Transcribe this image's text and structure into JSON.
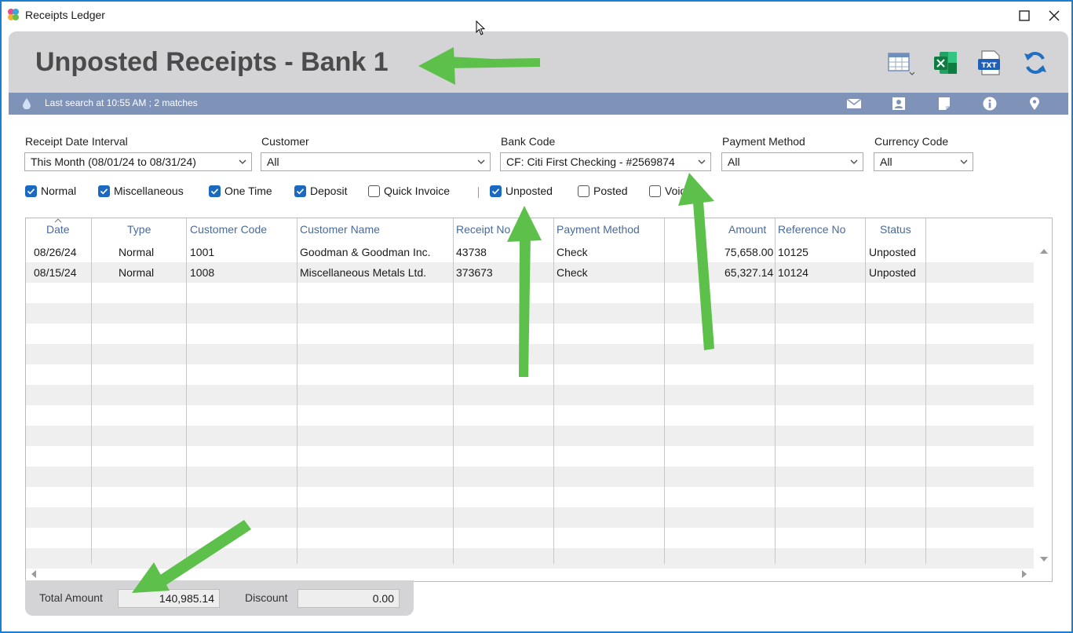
{
  "window": {
    "title": "Receipts Ledger",
    "max_glyph": "☐",
    "close_glyph": "✕"
  },
  "header": {
    "title": "Unposted Receipts - Bank 1",
    "tools": [
      {
        "icon": "column-chooser-icon"
      },
      {
        "icon": "excel-export-icon"
      },
      {
        "icon": "txt-export-icon"
      },
      {
        "icon": "refresh-icon"
      }
    ]
  },
  "statusbar": {
    "text": "Last search at 10:55 AM ; 2 matches",
    "icons": [
      "mail-icon",
      "contact-icon",
      "note-icon",
      "info-icon",
      "location-pin-icon"
    ],
    "bg_color": "#7f92b8"
  },
  "filters": {
    "receipt_date": {
      "label": "Receipt Date Interval",
      "value": "This Month (08/01/24 to 08/31/24)"
    },
    "customer": {
      "label": "Customer",
      "value": "All"
    },
    "bank_code": {
      "label": "Bank Code",
      "value": "CF: Citi First Checking - #2569874"
    },
    "payment_method": {
      "label": "Payment Method",
      "value": "All"
    },
    "currency_code": {
      "label": "Currency Code",
      "value": "All"
    }
  },
  "checkboxes": {
    "normal": {
      "label": "Normal",
      "checked": true
    },
    "miscellaneous": {
      "label": "Miscellaneous",
      "checked": true
    },
    "one_time": {
      "label": "One Time",
      "checked": true
    },
    "deposit": {
      "label": "Deposit",
      "checked": true
    },
    "quick_invoice": {
      "label": "Quick Invoice",
      "checked": false
    },
    "unposted": {
      "label": "Unposted",
      "checked": true
    },
    "posted": {
      "label": "Posted",
      "checked": false
    },
    "void": {
      "label": "Void",
      "checked": false
    }
  },
  "grid": {
    "columns": {
      "date": "Date",
      "type": "Type",
      "customer_code": "Customer Code",
      "customer_name": "Customer Name",
      "receipt_no": "Receipt No",
      "payment_method": "Payment Method",
      "amount": "Amount",
      "reference_no": "Reference No",
      "status": "Status"
    },
    "rows": [
      {
        "date": "08/26/24",
        "type": "Normal",
        "customer_code": "1001",
        "customer_name": "Goodman & Goodman Inc.",
        "receipt_no": "43738",
        "payment_method": "Check",
        "amount": "75,658.00",
        "reference_no": "10125",
        "status": "Unposted"
      },
      {
        "date": "08/15/24",
        "type": "Normal",
        "customer_code": "1008",
        "customer_name": "Miscellaneous Metals Ltd.",
        "receipt_no": "373673",
        "payment_method": "Check",
        "amount": "65,327.14",
        "reference_no": "10124",
        "status": "Unposted"
      }
    ]
  },
  "footer": {
    "total_label": "Total Amount",
    "total_value": "140,985.14",
    "discount_label": "Discount",
    "discount_value": "0.00"
  },
  "annotation_color": "#5dc04a"
}
